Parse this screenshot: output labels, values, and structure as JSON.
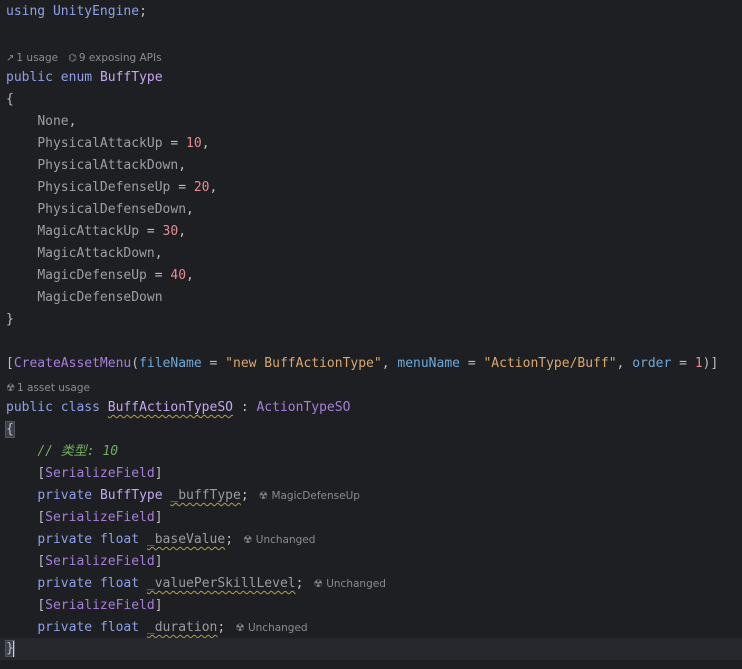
{
  "code": {
    "using_kw": "using",
    "using_ns": "UnityEngine",
    "using_end": ";",
    "enum_hint": {
      "usage_icon": "arrow-up-right-icon",
      "usage": "1 usage",
      "api_icon": "puzzle-icon",
      "apis": "9 exposing APIs"
    },
    "enum_decl": {
      "public": "public",
      "enum": "enum",
      "name": "BuffType"
    },
    "open_brace": "{",
    "close_brace": "}",
    "enum_members": [
      {
        "name": "None",
        "eq": "",
        "value": "",
        "end": ","
      },
      {
        "name": "PhysicalAttackUp",
        "eq": " = ",
        "value": "10",
        "end": ","
      },
      {
        "name": "PhysicalAttackDown",
        "eq": "",
        "value": "",
        "end": ","
      },
      {
        "name": "PhysicalDefenseUp",
        "eq": " = ",
        "value": "20",
        "end": ","
      },
      {
        "name": "PhysicalDefenseDown",
        "eq": "",
        "value": "",
        "end": ","
      },
      {
        "name": "MagicAttackUp",
        "eq": " = ",
        "value": "30",
        "end": ","
      },
      {
        "name": "MagicAttackDown",
        "eq": "",
        "value": "",
        "end": ","
      },
      {
        "name": "MagicDefenseUp",
        "eq": " = ",
        "value": "40",
        "end": ","
      },
      {
        "name": "MagicDefenseDown",
        "eq": "",
        "value": "",
        "end": ""
      }
    ],
    "attribute": {
      "lb": "[",
      "name": "CreateAssetMenu",
      "lp": "(",
      "p1": "fileName",
      "eq1": " = ",
      "v1": "\"new BuffActionType\"",
      "c1": ", ",
      "p2": "menuName",
      "eq2": " = ",
      "v2": "\"ActionType/Buff\"",
      "c2": ", ",
      "p3": "order",
      "eq3": " = ",
      "v3": "1",
      "rp": ")",
      "rb": "]"
    },
    "class_hint": {
      "icon": "unity-icon",
      "text": "1 asset usage"
    },
    "class_decl": {
      "public": "public",
      "class": "class",
      "name": "BuffActionTypeSO",
      "colon": " : ",
      "base": "ActionTypeSO"
    },
    "comment": "// 类型: 10",
    "fields": [
      {
        "attr_lb": "[",
        "attr": "SerializeField",
        "attr_rb": "]",
        "private": "private",
        "type": "BuffType",
        "name": "_buffType",
        "end": ";",
        "inlay_icon": "unity-icon",
        "inlay": "MagicDefenseUp"
      },
      {
        "attr_lb": "[",
        "attr": "SerializeField",
        "attr_rb": "]",
        "private": "private",
        "type": "float",
        "name": "_baseValue",
        "end": ";",
        "inlay_icon": "unity-icon",
        "inlay": "Unchanged"
      },
      {
        "attr_lb": "[",
        "attr": "SerializeField",
        "attr_rb": "]",
        "private": "private",
        "type": "float",
        "name": "_valuePerSkillLevel",
        "end": ";",
        "inlay_icon": "unity-icon",
        "inlay": "Unchanged"
      },
      {
        "attr_lb": "[",
        "attr": "SerializeField",
        "attr_rb": "]",
        "private": "private",
        "type": "float",
        "name": "_duration",
        "end": ";",
        "inlay_icon": "unity-icon",
        "inlay": "Unchanged"
      }
    ],
    "colors": {
      "background": "#1e1f22",
      "keyword": "#8ea1e8",
      "number": "#e58b93",
      "string": "#d9a86f",
      "comment": "#6fae62",
      "type": "#a67fdb"
    }
  }
}
